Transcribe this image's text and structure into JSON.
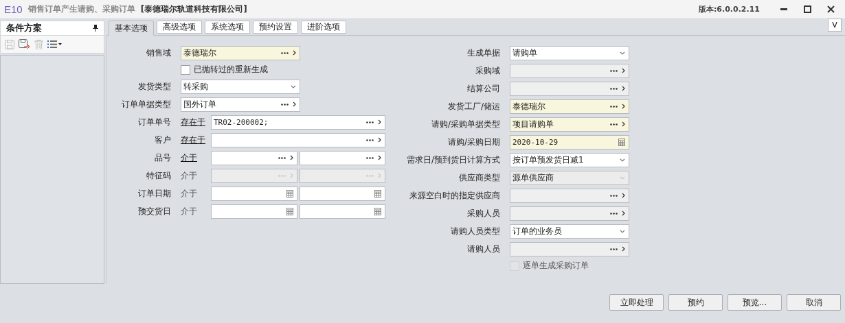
{
  "window": {
    "logo": "E10",
    "title": "销售订单产生请购、采购订单",
    "company": "[泰德瑞尔轨道科技有限公司]",
    "version": "版本:6.0.0.2.11"
  },
  "side_panel": {
    "title": "条件方案"
  },
  "tabs": [
    {
      "label": "基本选项",
      "selected": true
    },
    {
      "label": "高级选项",
      "selected": false
    },
    {
      "label": "系统选项",
      "selected": false
    },
    {
      "label": "预约设置",
      "selected": false
    },
    {
      "label": "进阶选项",
      "selected": false
    }
  ],
  "corner_button": "V",
  "left_rows": [
    {
      "kind": "field",
      "label": "销售域",
      "fields": [
        {
          "kind": "lookup",
          "value": "泰德瑞尔",
          "required": true,
          "readonly": false,
          "disabled": false
        }
      ]
    },
    {
      "kind": "checkbox",
      "label": "已抛转过的重新生成",
      "checked": false,
      "disabled": false
    },
    {
      "kind": "field",
      "label": "发货类型",
      "fields": [
        {
          "kind": "select",
          "value": "转采购",
          "required": false,
          "readonly": false,
          "disabled": false
        }
      ]
    },
    {
      "kind": "field",
      "label": "订单单据类型",
      "fields": [
        {
          "kind": "lookup",
          "value": "国外订单",
          "required": false,
          "readonly": false,
          "disabled": false
        }
      ]
    },
    {
      "kind": "field",
      "label": "订单单号",
      "operator": {
        "text": "存在于",
        "link": true
      },
      "fields": [
        {
          "kind": "lookup",
          "value": "TR02-200002;",
          "required": false,
          "readonly": false,
          "disabled": false
        }
      ]
    },
    {
      "kind": "field",
      "label": "客户",
      "operator": {
        "text": "存在于",
        "link": true
      },
      "fields": [
        {
          "kind": "lookup",
          "required": false,
          "readonly": false,
          "disabled": false
        }
      ]
    },
    {
      "kind": "field",
      "label": "品号",
      "operator": {
        "text": "介于",
        "link": true
      },
      "fields": [
        {
          "kind": "lookup",
          "required": false,
          "readonly": false,
          "disabled": false
        },
        {
          "kind": "lookup",
          "required": false,
          "readonly": false,
          "disabled": false
        }
      ]
    },
    {
      "kind": "field",
      "label": "特征码",
      "operator": {
        "text": "介于",
        "link": false
      },
      "fields": [
        {
          "kind": "lookup",
          "required": false,
          "readonly": false,
          "disabled": true
        },
        {
          "kind": "lookup",
          "required": false,
          "readonly": false,
          "disabled": true
        }
      ]
    },
    {
      "kind": "field",
      "label": "订单日期",
      "operator": {
        "text": "介于",
        "link": false
      },
      "fields": [
        {
          "kind": "date",
          "required": false,
          "readonly": false,
          "disabled": false
        },
        {
          "kind": "date",
          "required": false,
          "readonly": false,
          "disabled": false
        }
      ]
    },
    {
      "kind": "field",
      "label": "预交货日",
      "operator": {
        "text": "介于",
        "link": false
      },
      "fields": [
        {
          "kind": "date",
          "required": false,
          "readonly": false,
          "disabled": false
        },
        {
          "kind": "date",
          "required": false,
          "readonly": false,
          "disabled": false
        }
      ]
    }
  ],
  "right_rows": [
    {
      "kind": "field",
      "label": "生成单据",
      "fields": [
        {
          "kind": "select",
          "value": "请购单",
          "required": false,
          "readonly": false,
          "disabled": false
        }
      ]
    },
    {
      "kind": "field",
      "label": "采购域",
      "fields": [
        {
          "kind": "lookup",
          "required": false,
          "readonly": true,
          "disabled": false
        }
      ]
    },
    {
      "kind": "field",
      "label": "结算公司",
      "fields": [
        {
          "kind": "lookup",
          "required": false,
          "readonly": true,
          "disabled": false
        }
      ]
    },
    {
      "kind": "field",
      "label": "发货工厂/储运",
      "fields": [
        {
          "kind": "lookup",
          "value": "泰德瑞尔",
          "required": true,
          "readonly": false,
          "disabled": false
        }
      ]
    },
    {
      "kind": "field",
      "label": "请购/采购单据类型",
      "fields": [
        {
          "kind": "lookup",
          "value": "项目请购单",
          "required": true,
          "readonly": false,
          "disabled": false
        }
      ]
    },
    {
      "kind": "field",
      "label": "请购/采购日期",
      "fields": [
        {
          "kind": "date",
          "value": "2020-10-29",
          "required": true,
          "readonly": false,
          "disabled": false
        }
      ]
    },
    {
      "kind": "field",
      "label": "需求日/预到货日计算方式",
      "fields": [
        {
          "kind": "select",
          "value": "按订单预发货日减1",
          "required": false,
          "readonly": false,
          "disabled": false
        }
      ]
    },
    {
      "kind": "field",
      "label": "供应商类型",
      "fields": [
        {
          "kind": "select",
          "value": "源单供应商",
          "required": false,
          "readonly": false,
          "disabled": true
        }
      ]
    },
    {
      "kind": "field",
      "label": "来源空白时的指定供应商",
      "fields": [
        {
          "kind": "lookup",
          "required": false,
          "readonly": true,
          "disabled": false
        }
      ]
    },
    {
      "kind": "field",
      "label": "采购人员",
      "fields": [
        {
          "kind": "lookup",
          "required": false,
          "readonly": true,
          "disabled": false
        }
      ]
    },
    {
      "kind": "field",
      "label": "请购人员类型",
      "fields": [
        {
          "kind": "select",
          "value": "订单的业务员",
          "required": false,
          "readonly": false,
          "disabled": false
        }
      ]
    },
    {
      "kind": "field",
      "label": "请购人员",
      "fields": [
        {
          "kind": "lookup",
          "required": false,
          "readonly": true,
          "disabled": false
        }
      ]
    },
    {
      "kind": "checkbox",
      "label": "逐单生成采购订单",
      "checked": false,
      "disabled": true
    }
  ],
  "buttons": [
    "立即处理",
    "预约",
    "预览...",
    "取消"
  ]
}
